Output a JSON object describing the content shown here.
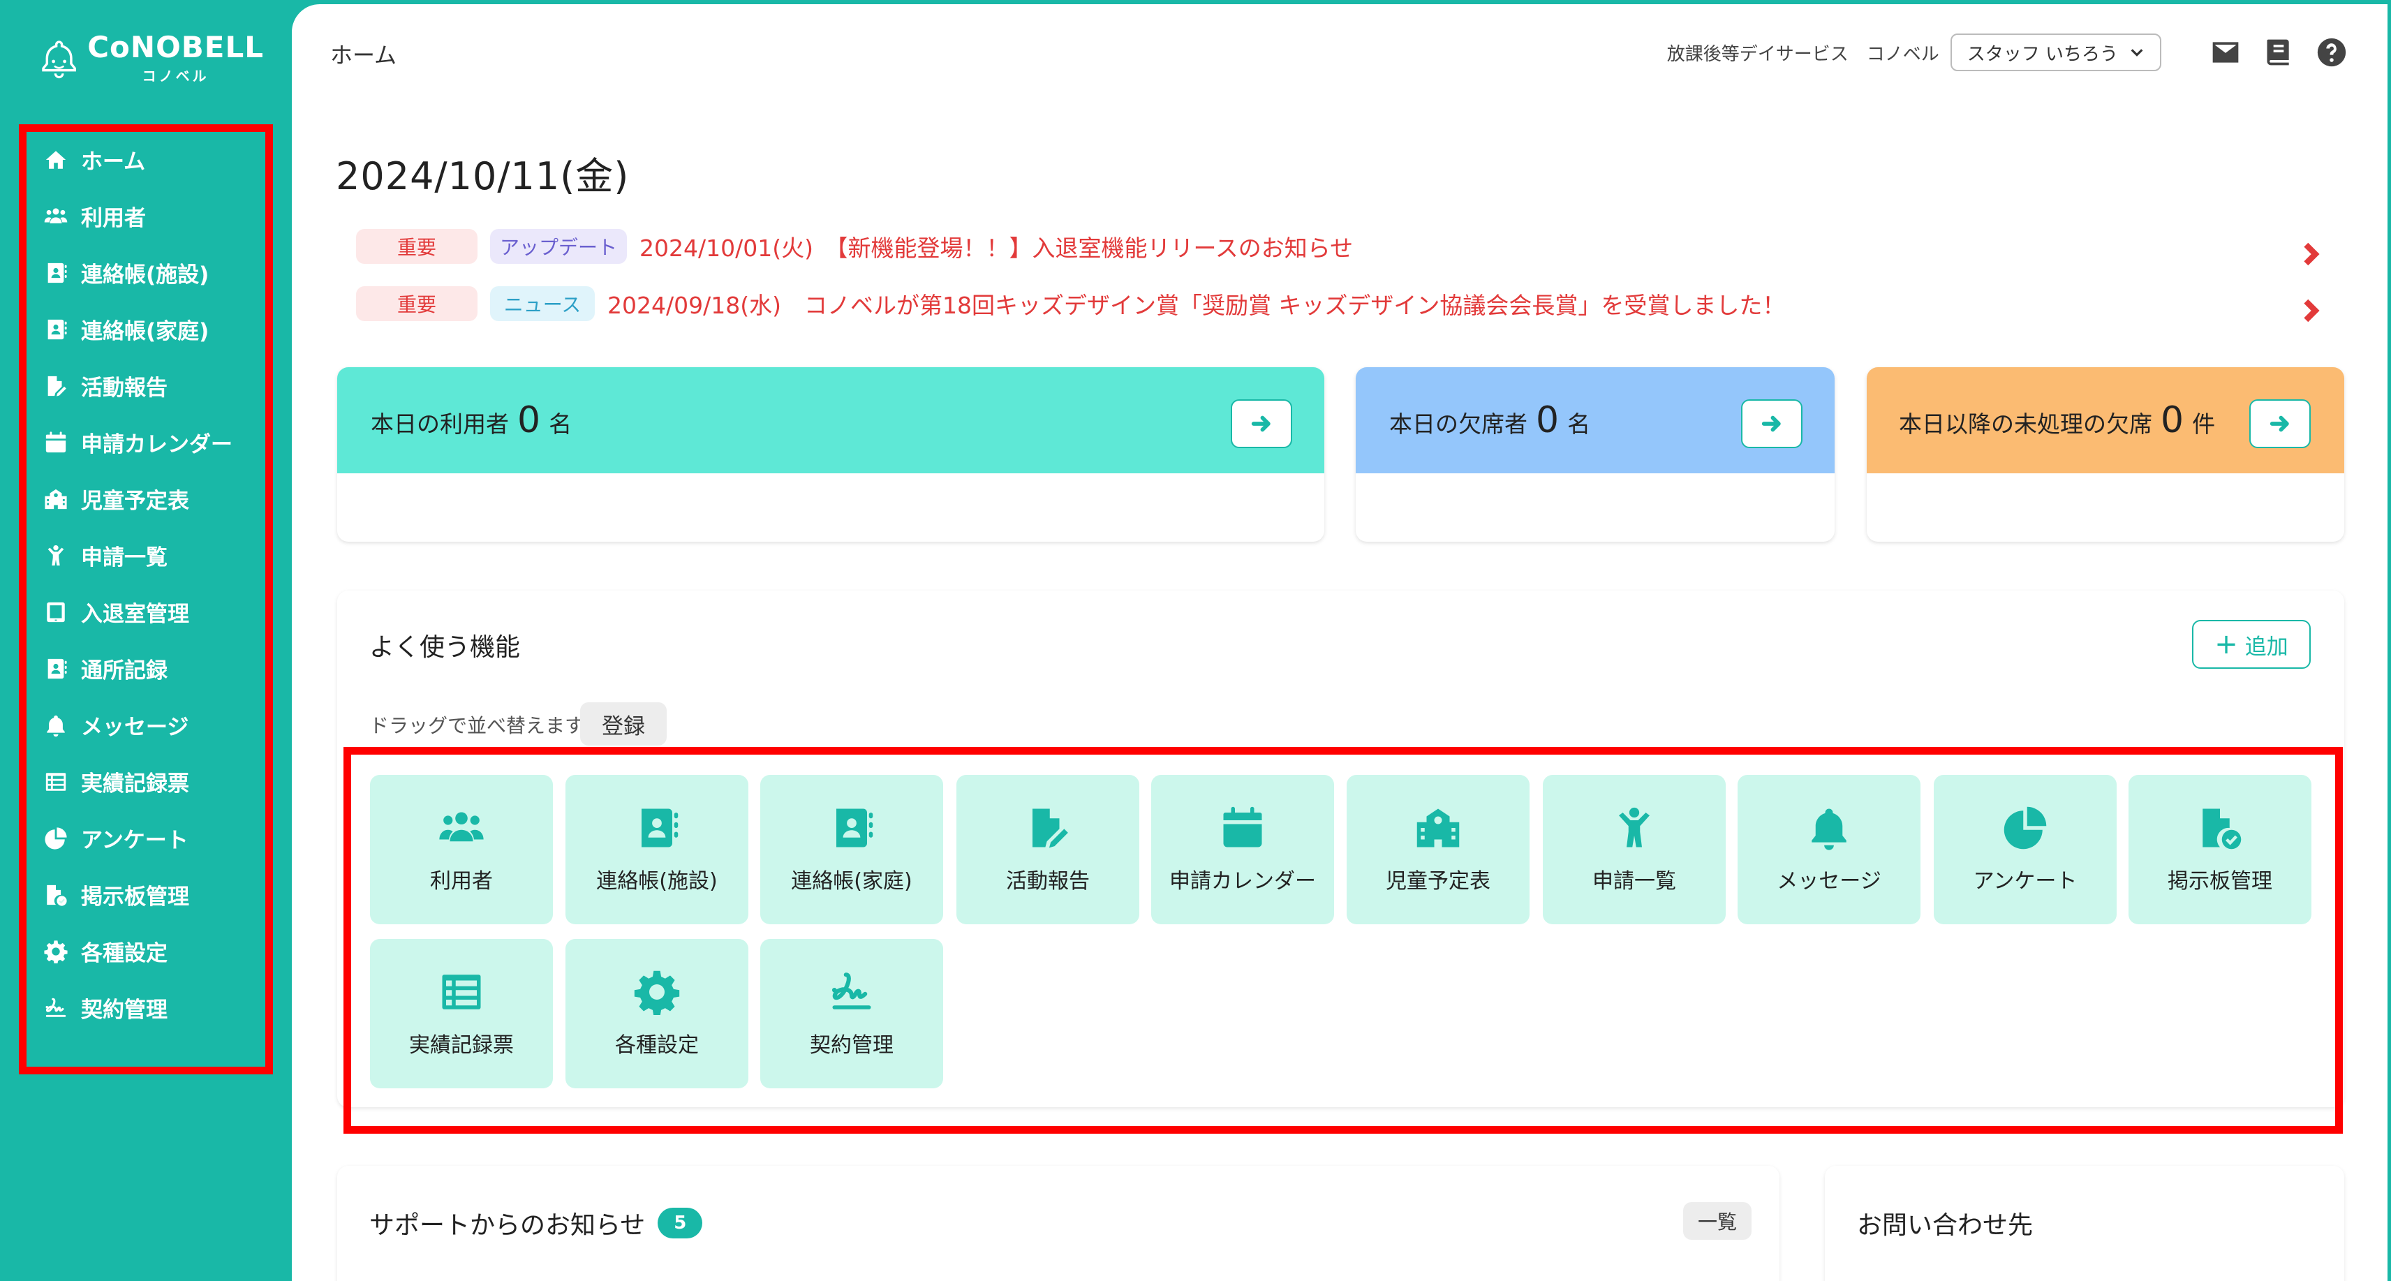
{
  "brand": {
    "name": "CoNOBELL",
    "sub": "コノベル"
  },
  "sidebar": {
    "items": [
      {
        "label": "ホーム",
        "icon": "home-icon"
      },
      {
        "label": "利用者",
        "icon": "users-icon"
      },
      {
        "label": "連絡帳(施設)",
        "icon": "contact-book-icon"
      },
      {
        "label": "連絡帳(家庭)",
        "icon": "contact-book-icon"
      },
      {
        "label": "活動報告",
        "icon": "file-edit-icon"
      },
      {
        "label": "申請カレンダー",
        "icon": "calendar-icon"
      },
      {
        "label": "児童予定表",
        "icon": "school-icon"
      },
      {
        "label": "申請一覧",
        "icon": "child-icon"
      },
      {
        "label": "入退室管理",
        "icon": "tablet-icon"
      },
      {
        "label": "通所記録",
        "icon": "contact-book-icon"
      },
      {
        "label": "メッセージ",
        "icon": "bell-icon"
      },
      {
        "label": "実績記録票",
        "icon": "list-icon"
      },
      {
        "label": "アンケート",
        "icon": "pie-chart-icon"
      },
      {
        "label": "掲示板管理",
        "icon": "file-check-icon"
      },
      {
        "label": "各種設定",
        "icon": "gear-icon"
      },
      {
        "label": "契約管理",
        "icon": "signature-icon"
      }
    ]
  },
  "header": {
    "title": "ホーム",
    "service": "放課後等デイサービス",
    "company": "コノベル",
    "user": "スタッフ いちろう"
  },
  "date": "2024/10/11(金)",
  "news": [
    {
      "importance": "重要",
      "category": "アップデート",
      "text": "2024/10/01(火)　【新機能登場！！】入退室機能リリースのお知らせ"
    },
    {
      "importance": "重要",
      "category": "ニュース",
      "text": "2024/09/18(水)　コノベルが第18回キッズデザイン賞「奨励賞 キッズデザイン協議会会長賞」を受賞しました！"
    }
  ],
  "stats": [
    {
      "prefix": "本日の利用者",
      "value": "0",
      "unit": "名",
      "color": "#5ee8d6"
    },
    {
      "prefix": "本日の欠席者",
      "value": "0",
      "unit": "名",
      "color": "#94c6fb"
    },
    {
      "prefix": "本日以降の未処理の欠席",
      "value": "0",
      "unit": "件",
      "color": "#fbbb72"
    }
  ],
  "favorites": {
    "title": "よく使う機能",
    "add_label": "追加",
    "hint": "ドラッグで並べ替えます。",
    "register_label": "登録",
    "tiles": [
      {
        "label": "利用者",
        "icon": "users-icon"
      },
      {
        "label": "連絡帳(施設)",
        "icon": "contact-book-icon"
      },
      {
        "label": "連絡帳(家庭)",
        "icon": "contact-book-icon"
      },
      {
        "label": "活動報告",
        "icon": "file-edit-icon"
      },
      {
        "label": "申請カレンダー",
        "icon": "calendar-icon"
      },
      {
        "label": "児童予定表",
        "icon": "school-icon"
      },
      {
        "label": "申請一覧",
        "icon": "child-icon"
      },
      {
        "label": "メッセージ",
        "icon": "bell-icon"
      },
      {
        "label": "アンケート",
        "icon": "pie-chart-icon"
      },
      {
        "label": "掲示板管理",
        "icon": "file-check-icon"
      },
      {
        "label": "実績記録票",
        "icon": "list-icon"
      },
      {
        "label": "各種設定",
        "icon": "gear-icon"
      },
      {
        "label": "契約管理",
        "icon": "signature-icon"
      }
    ]
  },
  "support": {
    "title": "サポートからのお知らせ",
    "count": "5",
    "list_label": "一覧"
  },
  "contact": {
    "title": "お問い合わせ先"
  },
  "colors": {
    "accent": "#19b8a7",
    "alert": "#e23a3a",
    "highlight": "#ff0000"
  }
}
